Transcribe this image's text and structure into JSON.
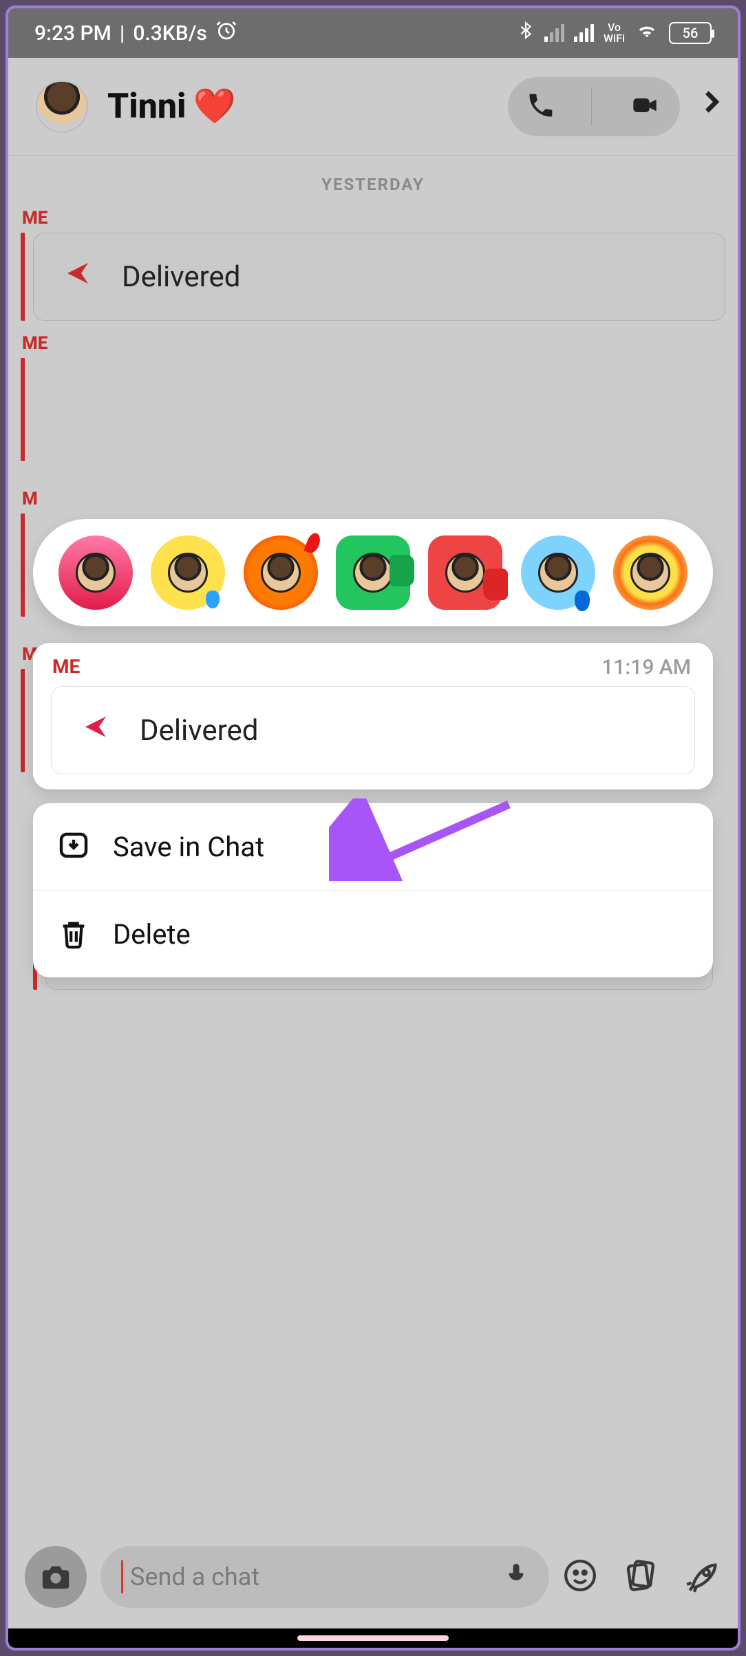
{
  "status": {
    "time": "9:23 PM",
    "net_speed": "0.3KB/s",
    "battery_pct": "56",
    "vowifi": "Vo\nWiFi"
  },
  "header": {
    "contact_name": "Tinni",
    "heart": "❤️"
  },
  "chat": {
    "date_separator_1": "YESTERDAY",
    "sender_me": "ME",
    "delivered": "Delivered"
  },
  "popup": {
    "sender": "ME",
    "time": "11:19 AM",
    "snap_status": "Delivered",
    "reactions": [
      "heart",
      "laugh",
      "fire",
      "thumbs-up",
      "thumbs-down",
      "tear",
      "mind-blown"
    ],
    "menu": {
      "save": "Save in Chat",
      "delete": "Delete"
    }
  },
  "input": {
    "placeholder": "Send a chat"
  }
}
